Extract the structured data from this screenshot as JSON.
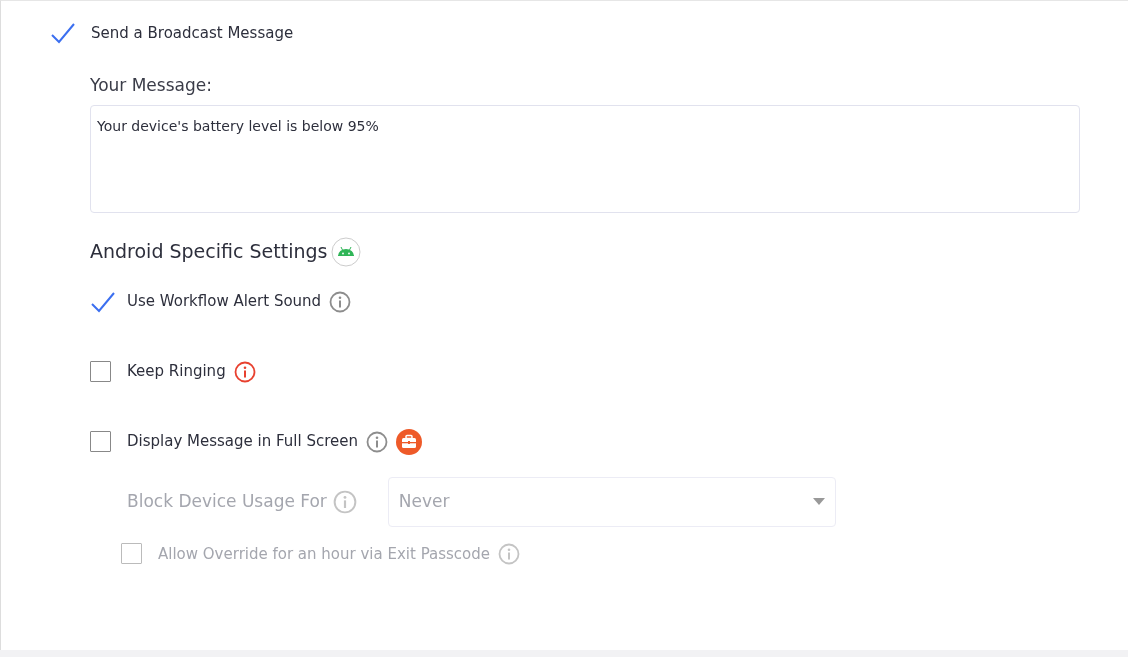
{
  "broadcast": {
    "label": "Send a Broadcast Message",
    "checked": true
  },
  "message": {
    "label": "Your Message:",
    "value": "Your device's battery level is below 95%"
  },
  "android": {
    "heading": "Android Specific Settings",
    "options": [
      {
        "label": "Use Workflow Alert Sound",
        "checked": true,
        "warning": false,
        "enterprise_badge": false
      },
      {
        "label": "Keep Ringing",
        "checked": false,
        "warning": true,
        "enterprise_badge": false
      },
      {
        "label": "Display Message in Full Screen",
        "checked": false,
        "warning": false,
        "enterprise_badge": true
      }
    ],
    "block": {
      "label": "Block Device Usage For",
      "value": "Never",
      "disabled": true
    },
    "override": {
      "label": "Allow Override for an hour via Exit Passcode",
      "checked": false,
      "disabled": true
    }
  }
}
